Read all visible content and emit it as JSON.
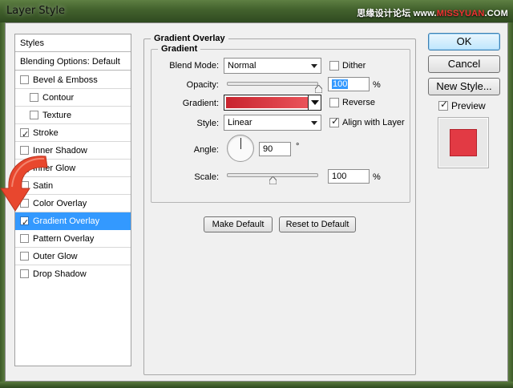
{
  "window": {
    "title": "Layer Style",
    "watermark_cn": "思缘设计论坛",
    "watermark_prefix": "www.",
    "watermark_highlight": "MISSYUAN",
    "watermark_suffix": ".COM"
  },
  "style_list": {
    "header": "Styles",
    "blending_options": "Blending Options: Default",
    "items": [
      {
        "label": "Bevel & Emboss",
        "checked": false
      },
      {
        "label": "Contour",
        "checked": false
      },
      {
        "label": "Texture",
        "checked": false
      },
      {
        "label": "Stroke",
        "checked": true
      },
      {
        "label": "Inner Shadow",
        "checked": false
      },
      {
        "label": "Inner Glow",
        "checked": false
      },
      {
        "label": "Satin",
        "checked": false
      },
      {
        "label": "Color Overlay",
        "checked": false
      },
      {
        "label": "Gradient Overlay",
        "checked": true
      },
      {
        "label": "Pattern Overlay",
        "checked": false
      },
      {
        "label": "Outer Glow",
        "checked": false
      },
      {
        "label": "Drop Shadow",
        "checked": false
      }
    ]
  },
  "gradient_overlay": {
    "group_title": "Gradient Overlay",
    "subgroup_title": "Gradient",
    "blend_mode_label": "Blend Mode:",
    "blend_mode_value": "Normal",
    "dither_label": "Dither",
    "dither_checked": false,
    "opacity_label": "Opacity:",
    "opacity_value": "100",
    "opacity_fraction": 1.0,
    "opacity_unit": "%",
    "gradient_label": "Gradient:",
    "gradient_colors": [
      "#c8242e",
      "#ee5a60"
    ],
    "reverse_label": "Reverse",
    "reverse_checked": false,
    "style_label": "Style:",
    "style_value": "Linear",
    "align_label": "Align with Layer",
    "align_checked": true,
    "angle_label": "Angle:",
    "angle_value": "90",
    "angle_unit": "°",
    "scale_label": "Scale:",
    "scale_value": "100",
    "scale_fraction": 0.5,
    "scale_unit": "%",
    "make_default_label": "Make Default",
    "reset_default_label": "Reset to Default"
  },
  "actions": {
    "ok_label": "OK",
    "cancel_label": "Cancel",
    "new_style_label": "New Style...",
    "preview_label": "Preview",
    "preview_checked": true
  },
  "colors": {
    "selection": "#3399ff",
    "preview_swatch": "#e23a44",
    "arrow": "#e8472e"
  }
}
